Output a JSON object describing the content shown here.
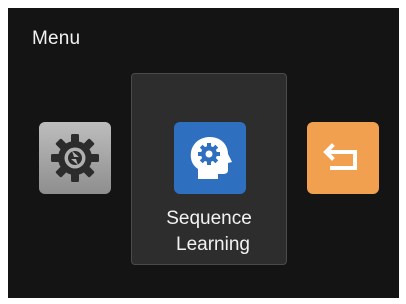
{
  "screen": {
    "title": "Menu"
  },
  "apps": [
    {
      "name": "Settings",
      "icon": "settings-gear-icon",
      "color": "#a6a6a6"
    },
    {
      "name_line1": "Sequence",
      "name_line2": "Learning",
      "icon": "head-gear-icon",
      "color": "#2f6fc0",
      "selected": true
    },
    {
      "name": "Return",
      "icon": "return-arrow-icon",
      "color": "#f0a04e"
    }
  ]
}
